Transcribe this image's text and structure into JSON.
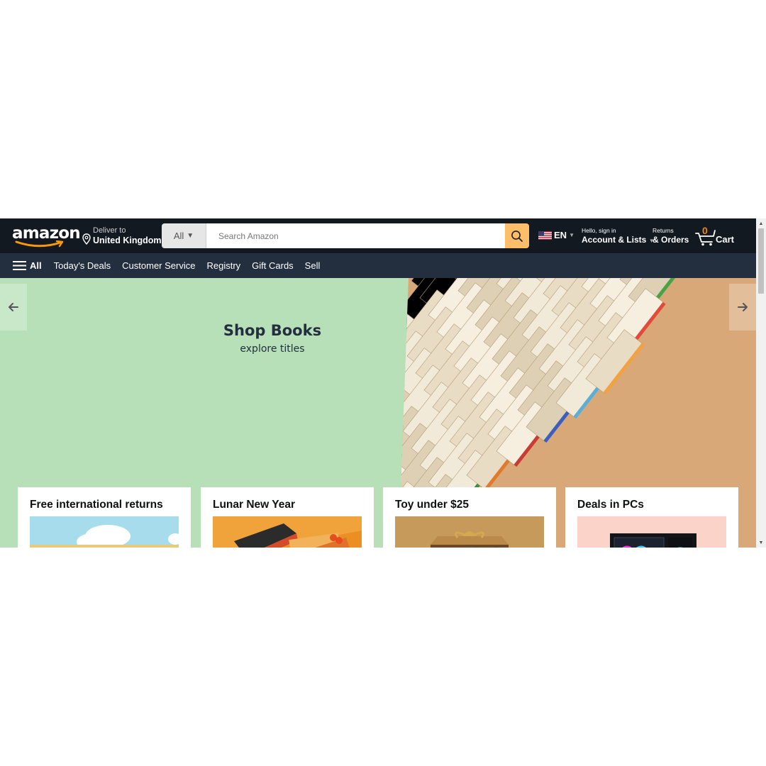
{
  "header": {
    "logo_text": "amazon",
    "deliver_label": "Deliver to",
    "deliver_location": "United Kingdom",
    "search_category": "All",
    "search_placeholder": "Search Amazon",
    "language": "EN",
    "account_greeting": "Hello, sign in",
    "account_label": "Account & Lists",
    "returns_label": "Returns",
    "orders_label": "& Orders",
    "cart_count": "0",
    "cart_label": "Cart"
  },
  "nav": {
    "all_label": "All",
    "items": [
      "Today's Deals",
      "Customer Service",
      "Registry",
      "Gift Cards",
      "Sell"
    ]
  },
  "hero": {
    "title": "Shop Books",
    "subtitle": "explore titles"
  },
  "cards": [
    {
      "title": "Free international returns"
    },
    {
      "title": "Lunar New Year"
    },
    {
      "title": "Toy under $25"
    },
    {
      "title": "Deals in PCs"
    }
  ],
  "colors": {
    "header_bg": "#131921",
    "nav_bg": "#232f3e",
    "search_button": "#febd69",
    "cart_count": "#f08804",
    "hero_bg": "#b7e0b8"
  },
  "icons": [
    "menu-icon",
    "location-pin-icon",
    "search-icon",
    "us-flag-icon",
    "cart-icon",
    "arrow-left-icon",
    "arrow-right-icon"
  ]
}
